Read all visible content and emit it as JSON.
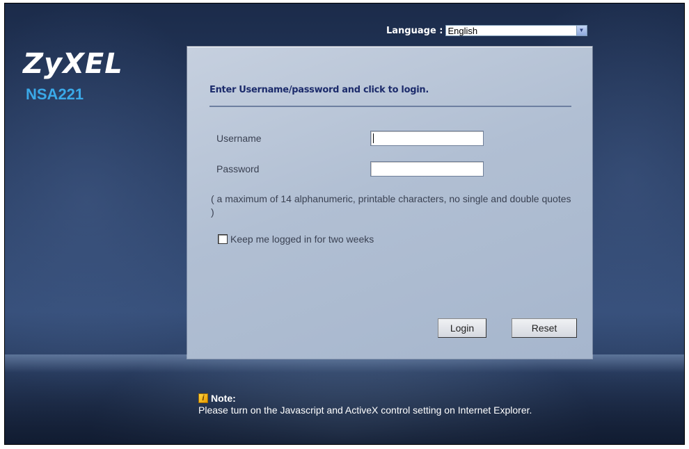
{
  "brand": {
    "logo_text": "ZyXEL",
    "model": "NSA221"
  },
  "language": {
    "label": "Language :",
    "selected": "English"
  },
  "login": {
    "title": "Enter Username/password and click to login.",
    "username_label": "Username",
    "username_value": "",
    "password_label": "Password",
    "password_value": "",
    "hint": "( a maximum of 14 alphanumeric, printable characters, no single and double quotes )",
    "keep_logged_label": "Keep me logged in for two weeks",
    "keep_logged_checked": false,
    "login_button": "Login",
    "reset_button": "Reset"
  },
  "note": {
    "heading": "Note:",
    "text": "Please turn on the Javascript and ActiveX control setting on Internet Explorer.",
    "icon": "note-icon"
  },
  "colors": {
    "background": "#2b4066",
    "model_text": "#3aa9e8",
    "panel": "#b1bfd3",
    "title_text": "#1c2b6b"
  }
}
